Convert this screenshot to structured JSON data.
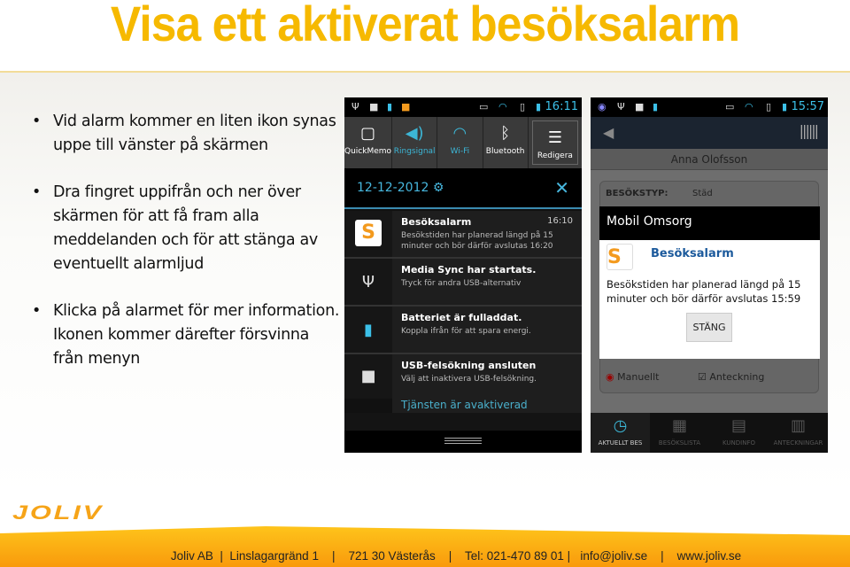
{
  "title": "Visa ett aktiverat besöksalarm",
  "bullets": [
    "Vid alarm kommer en liten ikon synas uppe till vänster på skärmen",
    "Dra fingret uppifrån och ner över skärmen för att få fram alla meddelanden och för att stänga av eventuellt alarmljud",
    "Klicka på alarmet för mer information. Ikonen kommer därefter försvinna från menyn"
  ],
  "phone1": {
    "time": "16:11",
    "quick_settings": [
      {
        "label": "QuickMemo",
        "icon": "quickmemo-icon"
      },
      {
        "label": "Ringsignal",
        "icon": "speaker-icon"
      },
      {
        "label": "Wi-Fi",
        "icon": "wifi-icon"
      },
      {
        "label": "Bluetooth",
        "icon": "bluetooth-icon"
      },
      {
        "label": "Redigera",
        "icon": "edit-list-icon"
      }
    ],
    "date": "12-12-2012",
    "notifications": [
      {
        "title": "Besöksalarm",
        "time": "16:10",
        "text": "Besökstiden har planerad längd på 15 minuter och bör därför avslutas 16:20",
        "icon": "joliv-app-icon"
      },
      {
        "title": "Media Sync har startats.",
        "text": "Tryck för andra USB-alternativ",
        "icon": "usb-icon"
      },
      {
        "title": "Batteriet är fulladdat.",
        "text": "Koppla ifrån för att spara energi.",
        "icon": "battery-icon"
      },
      {
        "title": "USB-felsökning ansluten",
        "text": "Välj att inaktivera USB-felsökning.",
        "icon": "android-debug-icon"
      }
    ],
    "service_status": "Tjänsten är avaktiverad"
  },
  "phone2": {
    "time": "15:57",
    "customer_name": "Anna Olofsson",
    "visit_type_label": "BESÖKSTYP:",
    "visit_type_value": "Städ",
    "dialog": {
      "title": "Mobil Omsorg",
      "heading": "Besöksalarm",
      "message": "Besökstiden har planerad längd på 15 minuter och bör därför avslutas 15:59",
      "close_button": "STÄNG"
    },
    "manual_label": "Manuellt",
    "note_label": "Anteckning",
    "nav": [
      "AKTUELLT BES",
      "BESÖKSLISTA",
      "KUNDINFO",
      "ANTECKNINGAR"
    ]
  },
  "logo": "JOLIV",
  "footer": "Joliv AB  |  Linslagargränd 1    |    721 30 Västerås    |    Tel: 021-470 89 01 |   info@joliv.se    |    www.joliv.se",
  "colors": {
    "title": "#f6b900",
    "accent_blue": "#3cc0e8",
    "footer": "#fdb514"
  }
}
